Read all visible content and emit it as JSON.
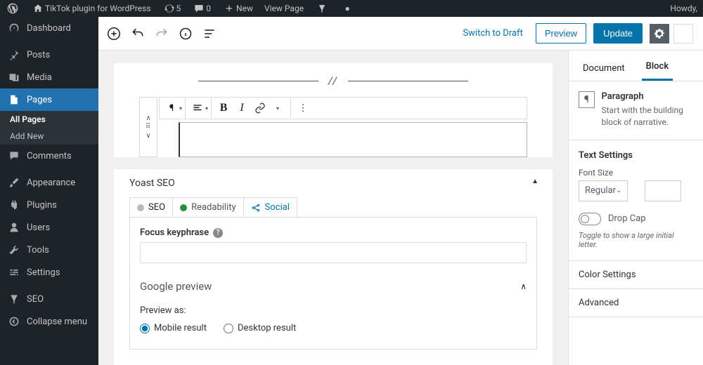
{
  "adminbar": {
    "site_title": "TikTok plugin for WordPress",
    "updates_count": "5",
    "comments_count": "0",
    "new_label": "New",
    "view_page": "View Page",
    "howdy": "Howdy,"
  },
  "adminmenu": {
    "items": [
      {
        "label": "Dashboard",
        "icon": "dashboard"
      },
      {
        "label": "Posts",
        "icon": "pin"
      },
      {
        "label": "Media",
        "icon": "media"
      },
      {
        "label": "Pages",
        "icon": "page",
        "active": true,
        "submenu": [
          {
            "label": "All Pages",
            "selected": true
          },
          {
            "label": "Add New"
          }
        ]
      },
      {
        "label": "Comments",
        "icon": "comment"
      },
      {
        "label": "Appearance",
        "icon": "brush"
      },
      {
        "label": "Plugins",
        "icon": "plug"
      },
      {
        "label": "Users",
        "icon": "user"
      },
      {
        "label": "Tools",
        "icon": "wrench"
      },
      {
        "label": "Settings",
        "icon": "sliders"
      },
      {
        "label": "SEO",
        "icon": "yoast"
      },
      {
        "label": "Collapse menu",
        "icon": "collapse"
      }
    ]
  },
  "editor_bar": {
    "switch_draft": "Switch to Draft",
    "preview": "Preview",
    "update": "Update"
  },
  "yoast": {
    "title": "Yoast SEO",
    "tabs": {
      "seo": "SEO",
      "readability": "Readability",
      "social": "Social"
    },
    "focus_label": "Focus keyphrase",
    "google_preview": "Google preview",
    "preview_as": "Preview as:",
    "mobile": "Mobile result",
    "desktop": "Desktop result"
  },
  "inspector": {
    "tabs": {
      "document": "Document",
      "block": "Block"
    },
    "block_name": "Paragraph",
    "block_desc": "Start with the building block of narrative.",
    "text_settings": "Text Settings",
    "font_size_label": "Font Size",
    "font_size_value": "Regular",
    "drop_cap": "Drop Cap",
    "drop_cap_hint": "Toggle to show a large initial letter.",
    "color_settings": "Color Settings",
    "advanced": "Advanced"
  }
}
